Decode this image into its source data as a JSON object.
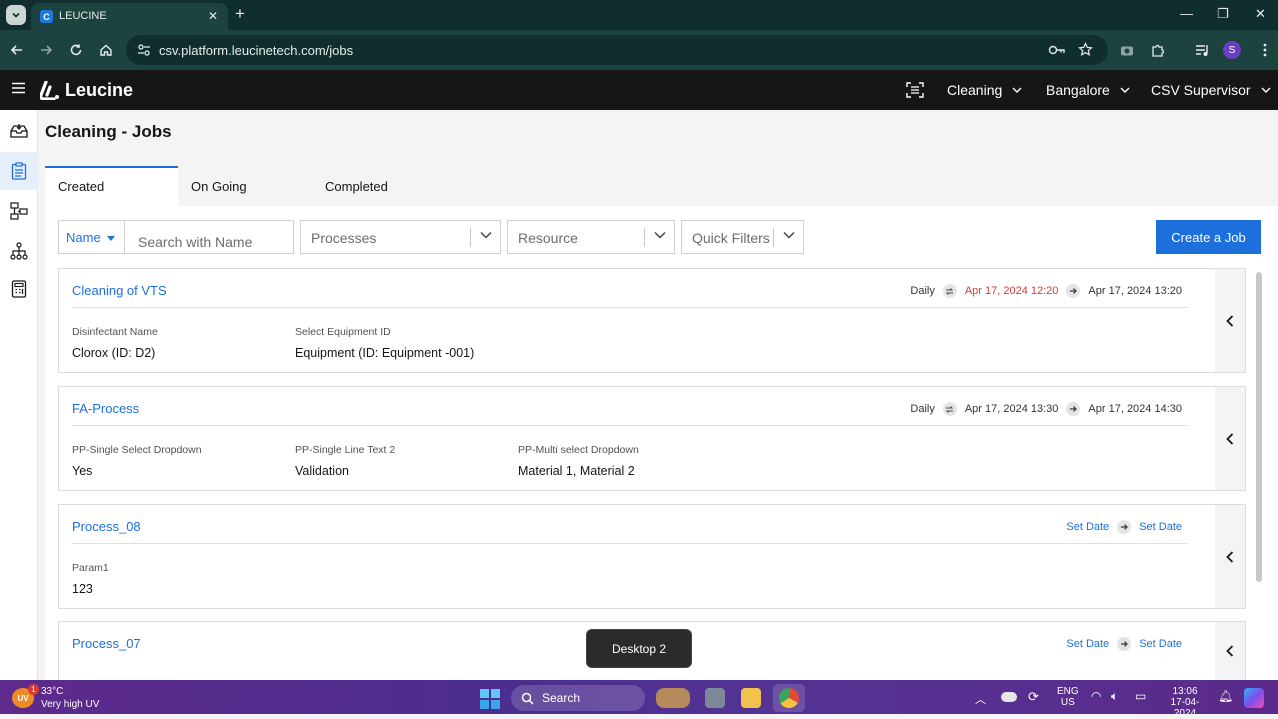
{
  "browser": {
    "tab_title": "LEUCINE",
    "tab_favicon_letter": "C",
    "url": "csv.platform.leucinetech.com/jobs",
    "profile_initial": "S"
  },
  "app": {
    "logo_text": "Leucine",
    "header": {
      "use_case": "Cleaning",
      "facility": "Bangalore",
      "role": "CSV Supervisor"
    }
  },
  "page": {
    "title": "Cleaning - Jobs",
    "tabs": [
      {
        "label": "Created",
        "active": true
      },
      {
        "label": "On Going",
        "active": false
      },
      {
        "label": "Completed",
        "active": false
      }
    ],
    "filters": {
      "field_select": "Name",
      "search_placeholder": "Search with Name",
      "processes_placeholder": "Processes",
      "resource_placeholder": "Resource",
      "quick_filters_placeholder": "Quick Filters"
    },
    "create_button": "Create a Job",
    "jobs": [
      {
        "name": "Cleaning of VTS",
        "frequency": "Daily",
        "start": "Apr 17, 2024 12:20",
        "end": "Apr 17, 2024 13:20",
        "start_overdue": true,
        "properties": [
          {
            "label": "Disinfectant Name",
            "value": "Clorox (ID: D2)"
          },
          {
            "label": "Select Equipment ID",
            "value": "Equipment (ID: Equipment -001)"
          }
        ]
      },
      {
        "name": "FA-Process",
        "frequency": "Daily",
        "start": "Apr 17, 2024 13:30",
        "end": "Apr 17, 2024 14:30",
        "start_overdue": false,
        "properties": [
          {
            "label": "PP-Single Select Dropdown",
            "value": "Yes"
          },
          {
            "label": "PP-Single Line Text 2",
            "value": "Validation"
          },
          {
            "label": "PP-Multi select Dropdown",
            "value": "Material 1, Material 2"
          }
        ]
      },
      {
        "name": "Process_08",
        "start": "Set Date",
        "end": "Set Date",
        "properties": [
          {
            "label": "Param1",
            "value": "123"
          }
        ]
      },
      {
        "name": "Process_07",
        "start": "Set Date",
        "end": "Set Date",
        "properties": []
      }
    ]
  },
  "tooltip": "Desktop 2",
  "taskbar": {
    "weather_temp": "33°C",
    "weather_desc": "Very high UV",
    "weather_badge": "1",
    "weather_icon_text": "UV",
    "search_label": "Search",
    "language": "ENG",
    "region": "US",
    "time": "13:06",
    "date": "17-04-2024"
  },
  "colors": {
    "primary": "#1d6fdc",
    "overdue": "#d43a2f",
    "appbar": "#161616",
    "chrome": "#1c4340"
  }
}
